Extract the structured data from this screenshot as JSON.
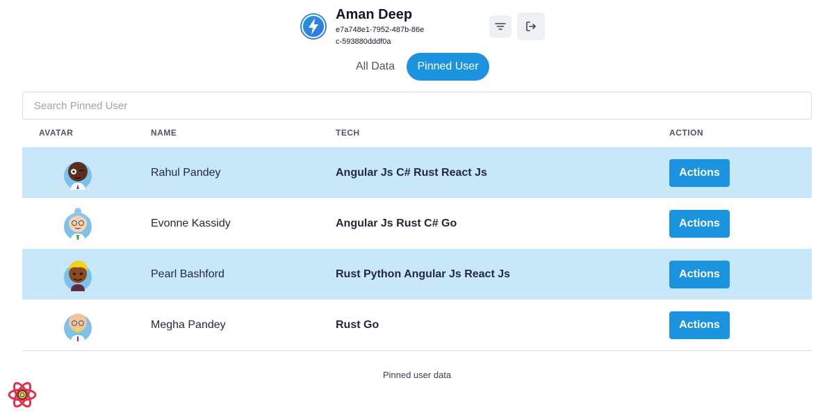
{
  "header": {
    "user_name": "Aman Deep",
    "user_id": "e7a748e1-7952-487b-86ec-593880dddf0a",
    "logo_icon": "lightning-bolt-icon",
    "filter_icon": "filter-icon",
    "logout_icon": "logout-icon"
  },
  "tabs": [
    {
      "label": "All Data",
      "active": false
    },
    {
      "label": "Pinned User",
      "active": true
    }
  ],
  "search": {
    "placeholder": "Search Pinned User",
    "value": ""
  },
  "table": {
    "columns": [
      "AVATAR",
      "NAME",
      "TECH",
      "ACTION"
    ],
    "rows": [
      {
        "name": "Rahul Pandey",
        "tech": "Angular Js C# Rust React Js",
        "action": "Actions",
        "highlighted": true
      },
      {
        "name": "Evonne Kassidy",
        "tech": "Angular Js Rust C# Go",
        "action": "Actions",
        "highlighted": false
      },
      {
        "name": "Pearl Bashford",
        "tech": "Rust Python Angular Js React Js",
        "action": "Actions",
        "highlighted": true
      },
      {
        "name": "Megha Pandey",
        "tech": "Rust Go",
        "action": "Actions",
        "highlighted": false
      }
    ]
  },
  "footer": {
    "text": "Pinned user data"
  },
  "colors": {
    "accent": "#1c93de",
    "row_highlight": "#c8e7f9"
  }
}
